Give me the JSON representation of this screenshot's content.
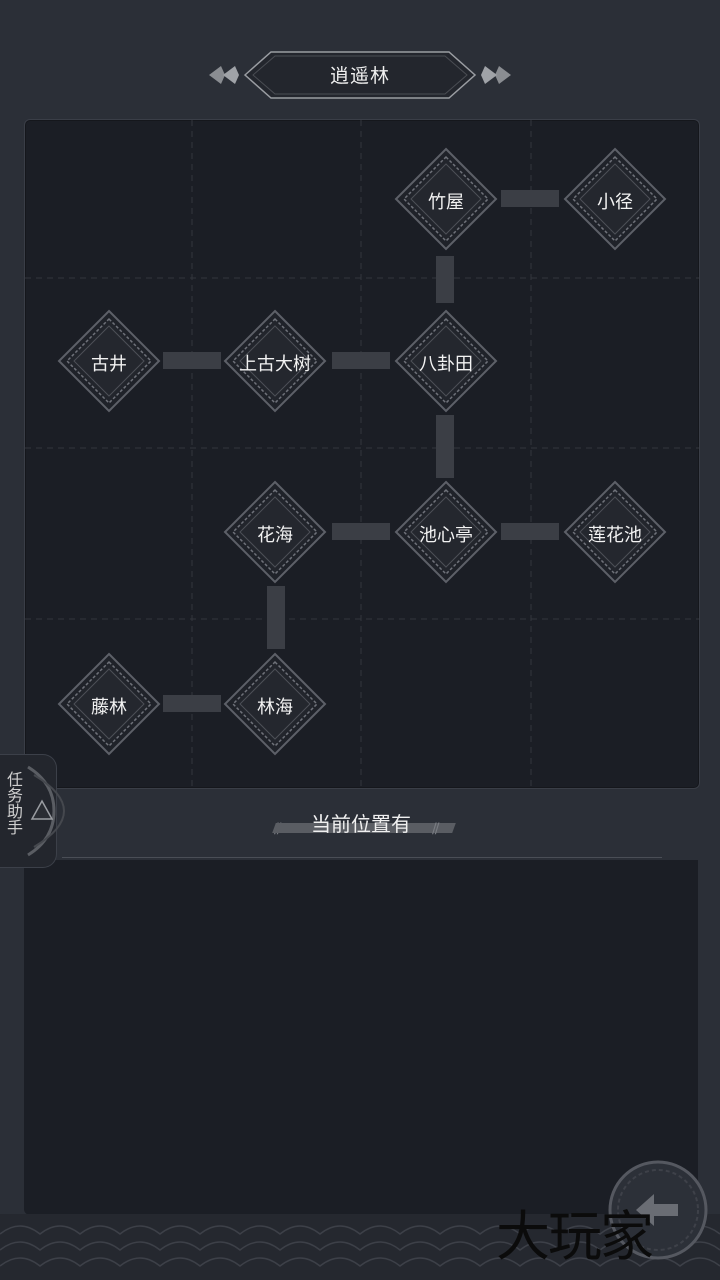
{
  "header": {
    "title": "逍遥林"
  },
  "map": {
    "nodes": [
      {
        "id": "bamboo-hut",
        "label": "竹屋"
      },
      {
        "id": "path",
        "label": "小径"
      },
      {
        "id": "old-well",
        "label": "古井"
      },
      {
        "id": "ancient-tree",
        "label": "上古大树"
      },
      {
        "id": "bagua-field",
        "label": "八卦田"
      },
      {
        "id": "flower-sea",
        "label": "花海"
      },
      {
        "id": "pavilion",
        "label": "池心亭"
      },
      {
        "id": "lotus-pond",
        "label": "莲花池"
      },
      {
        "id": "vine-forest",
        "label": "藤林"
      },
      {
        "id": "forest-sea",
        "label": "林海"
      }
    ]
  },
  "location": {
    "title": "当前位置有"
  },
  "side_tab": {
    "label": "任务助手"
  },
  "watermark": {
    "text": "大玩家"
  },
  "colors": {
    "background": "#2b2f37",
    "panel": "#1b1e25",
    "node_border": "#6b6e75",
    "link": "#3b3e45"
  },
  "icons": {
    "back": "back-arrow-icon",
    "side": "triangle-icon"
  }
}
